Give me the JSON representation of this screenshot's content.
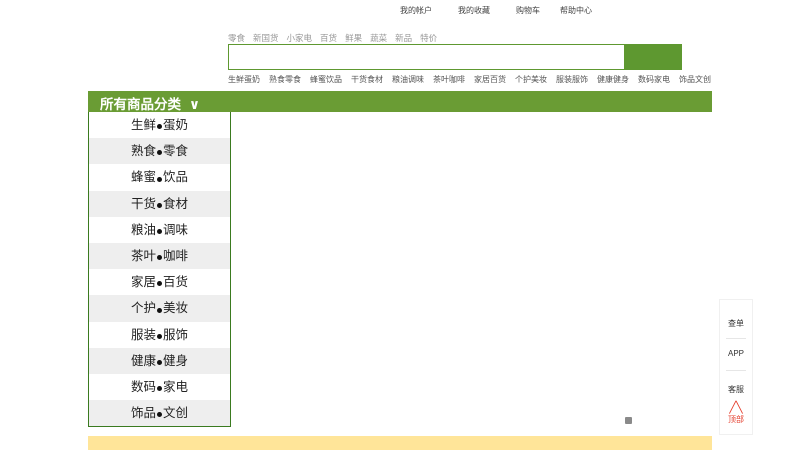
{
  "top_links": [
    "我的帐户",
    "我的收藏",
    "购物车",
    "帮助中心"
  ],
  "hot_words": [
    "零食",
    "新国货",
    "小家电",
    "百货",
    "鲜果",
    "蔬菜",
    "新品",
    "特价"
  ],
  "search": {
    "placeholder": ""
  },
  "category_links": [
    "生鲜蛋奶",
    "熟食零食",
    "蜂蜜饮品",
    "干货食材",
    "粮油调味",
    "茶叶咖啡",
    "家居百货",
    "个护美妆",
    "服装服饰",
    "健康健身",
    "数码家电",
    "饰品文创"
  ],
  "nav": {
    "all_categories": "所有商品分类",
    "arrow": "∨"
  },
  "categories": [
    [
      "生鲜",
      "蛋奶"
    ],
    [
      "熟食",
      "零食"
    ],
    [
      "蜂蜜",
      "饮品"
    ],
    [
      "干货",
      "食材"
    ],
    [
      "粮油",
      "调味"
    ],
    [
      "茶叶",
      "咖啡"
    ],
    [
      "家居",
      "百货"
    ],
    [
      "个护",
      "美妆"
    ],
    [
      "服装",
      "服饰"
    ],
    [
      "健康",
      "健身"
    ],
    [
      "数码",
      "家电"
    ],
    [
      "饰品",
      "文创"
    ]
  ],
  "sidebar": {
    "order_check": "查单",
    "app": "APP",
    "service": "客服",
    "top": "顶部",
    "top_caret": "╱╲"
  },
  "colors": {
    "green": "#6a9c34",
    "footer": "#ffe599",
    "top_red": "#e43c2b"
  }
}
